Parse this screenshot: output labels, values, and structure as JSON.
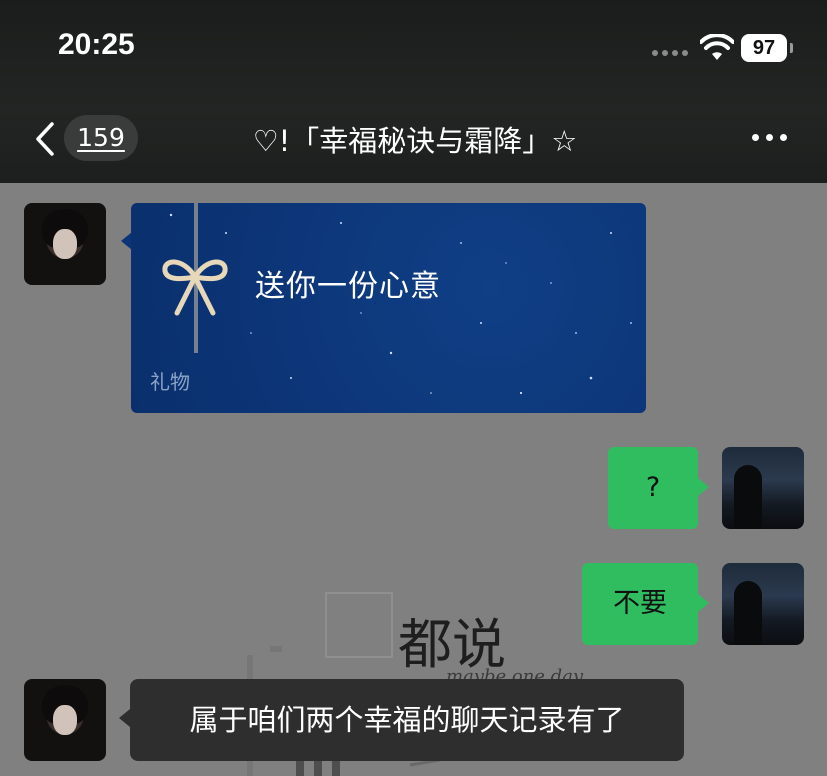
{
  "status_bar": {
    "time": "20:25",
    "battery": "97"
  },
  "nav": {
    "unread_count": "159",
    "title": "♡!「幸福秘诀与霜降」☆"
  },
  "messages": [
    {
      "side": "left",
      "type": "gift",
      "text": "送你一份心意",
      "label": "礼物"
    },
    {
      "side": "right",
      "type": "text",
      "text": "?"
    },
    {
      "side": "right",
      "type": "text",
      "text": "不要"
    },
    {
      "side": "left",
      "type": "text",
      "text": "属于咱们两个幸福的聊天记录有了"
    }
  ],
  "background_art": {
    "title": "都说",
    "subtitle": "maybe one day"
  },
  "colors": {
    "green_bubble": "#2fbd5f",
    "gift_card": "#0c3577",
    "dark_bubble": "#2e2e2e"
  }
}
